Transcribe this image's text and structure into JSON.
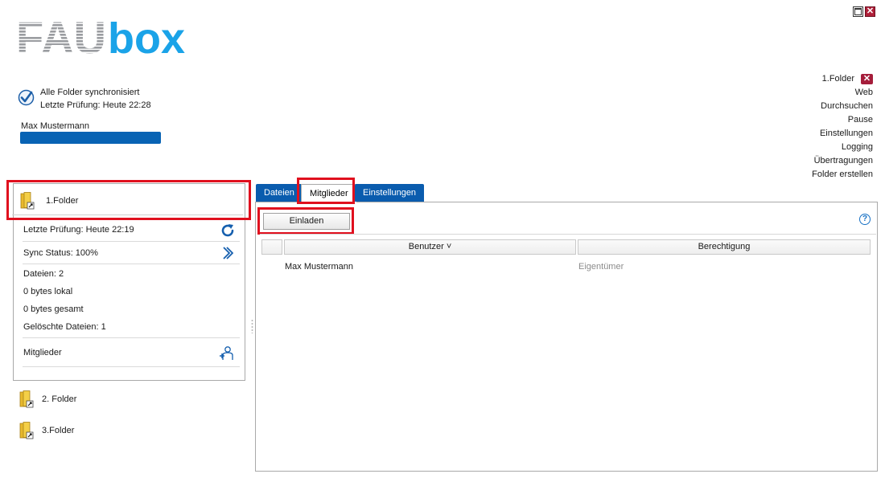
{
  "window": {
    "maximize_icon": "maximize-icon",
    "close_icon": "close-icon"
  },
  "logo": {
    "part1": "FAU",
    "part2": "box",
    "gray": "#9a9ca0",
    "blue": "#1aa3e8"
  },
  "status": {
    "line1": "Alle Folder synchronisiert",
    "line2": "Letzte Prüfung: Heute 22:28",
    "icon": "check-circle-icon",
    "user": "Max Mustermann"
  },
  "right_menu": {
    "folder": "1.Folder",
    "items": [
      "Web",
      "Durchsuchen",
      "Pause",
      "Einstellungen",
      "Logging",
      "Übertragungen",
      "Folder erstellen"
    ]
  },
  "folder_panel": {
    "selected": "1.Folder",
    "last_check": "Letzte Prüfung: Heute 22:19",
    "sync_status": "Sync Status: 100%",
    "files": "Dateien: 2",
    "local": "0 bytes lokal",
    "total": "0 bytes gesamt",
    "deleted": "Gelöschte Dateien: 1",
    "members": "Mitglieder"
  },
  "folders": [
    "2. Folder",
    "3.Folder"
  ],
  "tabs": [
    "Dateien",
    "Mitglieder",
    "Einstellungen"
  ],
  "active_tab": "Mitglieder",
  "members_view": {
    "invite_button": "Einladen",
    "help_icon_text": "?",
    "columns": [
      "Benutzer ˅",
      "Berechtigung"
    ],
    "rows": [
      {
        "user": "Max Mustermann",
        "permission": "Eigentümer"
      }
    ]
  },
  "colors": {
    "accent_blue": "#0a5cae",
    "highlight_red": "#e0101e",
    "close_red": "#a51d3b"
  }
}
